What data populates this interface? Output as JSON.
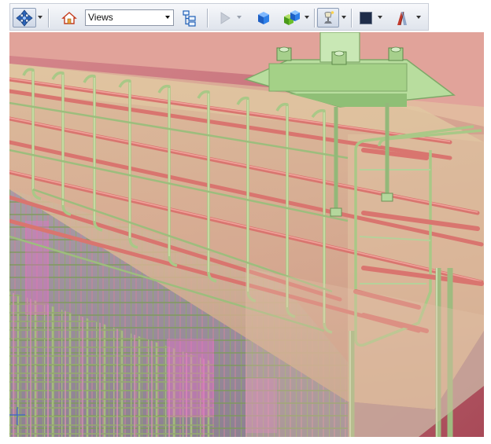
{
  "toolbar": {
    "navigate_icon": "navigate-cross-icon",
    "home_icon": "home-icon",
    "views_combo_value": "Views",
    "tree_icon": "model-tree-icon",
    "play_icon": "play-icon",
    "cube_icon": "solid-cube-icon",
    "multi_cube_icon": "multi-cube-icon",
    "lamp_icon": "lighting-icon",
    "background_color_icon": "background-color-icon",
    "section_icon": "section-plane-icon"
  },
  "viewport": {
    "scene": "3d-rebar-cage-model"
  }
}
